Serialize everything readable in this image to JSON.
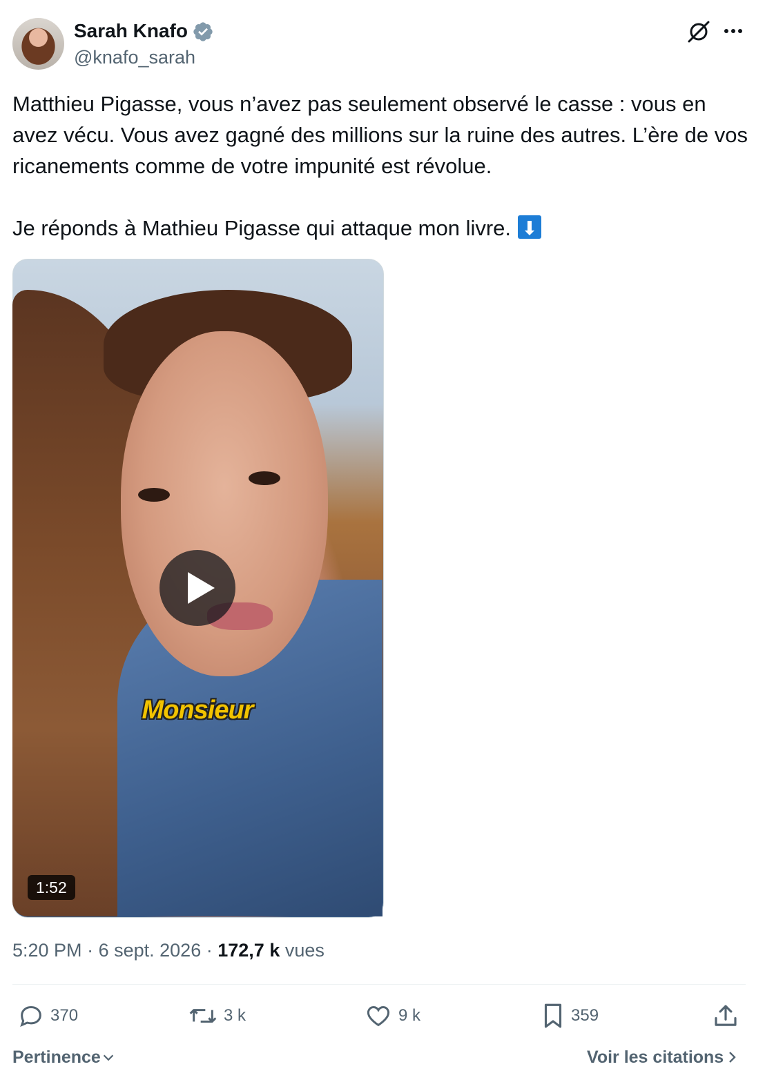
{
  "author": {
    "name": "Sarah Knafo",
    "handle": "@knafo_sarah",
    "verified": true,
    "avatar": "avatar"
  },
  "header_icons": [
    "grok-icon",
    "more-icon"
  ],
  "tweet": {
    "text": "Matthieu Pigasse, vous n’avez pas seulement observé le casse : vous en avez vécu. Vous avez gagné des millions sur la ruine des autres. L’ère de vos ricanements comme de votre impunité est révolue.\n\nJe réponds à Mathieu Pigasse qui attaque mon livre.",
    "emoji": "arrow-down-emoji"
  },
  "media": {
    "type": "video",
    "caption": "Monsieur",
    "duration": "1:52"
  },
  "meta": {
    "time": "5:20 PM",
    "separator": "·",
    "date": "6 sept. 2026",
    "views_count": "172,7 k",
    "views_label": "vues"
  },
  "actions": {
    "replies": "370",
    "retweets": "3 k",
    "likes": "9 k",
    "bookmarks": "359"
  },
  "footer": {
    "sort_label": "Pertinence",
    "quotes_label": "Voir les citations"
  },
  "colors": {
    "text": "#0f1419",
    "secondary": "#536471",
    "verified": "#829aab",
    "emoji_bg": "#1d7dd6"
  }
}
